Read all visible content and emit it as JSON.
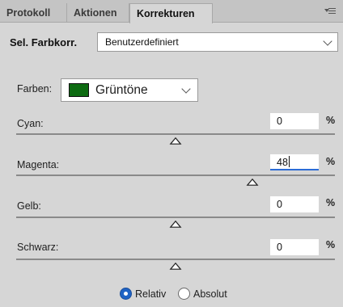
{
  "tabs": [
    {
      "label": "Protokoll",
      "active": false
    },
    {
      "label": "Aktionen",
      "active": false
    },
    {
      "label": "Korrekturen",
      "active": true
    }
  ],
  "preset": {
    "label": "Sel. Farbkorr.",
    "value": "Benutzerdefiniert"
  },
  "colors": {
    "label": "Farben:",
    "value": "Grüntöne",
    "swatch_color": "#0d6b11"
  },
  "sliders": [
    {
      "label": "Cyan:",
      "value": "0",
      "unit": "%",
      "fraction": 0.5
    },
    {
      "label": "Magenta:",
      "value": "48",
      "unit": "%",
      "fraction": 0.74,
      "focused": true
    },
    {
      "label": "Gelb:",
      "value": "0",
      "unit": "%",
      "fraction": 0.5
    },
    {
      "label": "Schwarz:",
      "value": "0",
      "unit": "%",
      "fraction": 0.5
    }
  ],
  "mode": {
    "options": [
      {
        "label": "Relativ",
        "selected": true
      },
      {
        "label": "Absolut",
        "selected": false
      }
    ]
  },
  "accent_color": "#2c6cd6"
}
